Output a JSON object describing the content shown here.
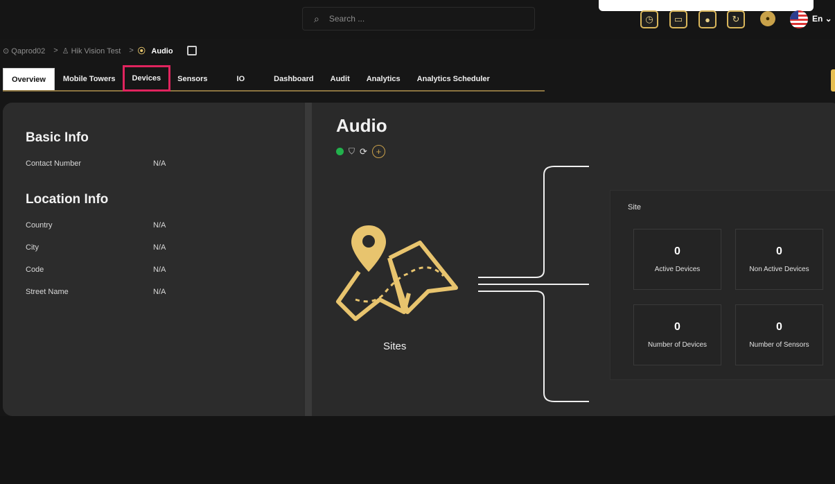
{
  "search": {
    "placeholder": "Search ..."
  },
  "topbar": {
    "lang": "En"
  },
  "breadcrumb": [
    {
      "label": "Qaprod02"
    },
    {
      "label": "Hik Vision Test"
    },
    {
      "label": "Audio"
    }
  ],
  "tabs": [
    {
      "label": "Overview"
    },
    {
      "label": "Mobile Towers"
    },
    {
      "label": "Devices"
    },
    {
      "label": "Sensors"
    },
    {
      "label": "IO"
    },
    {
      "label": "Dashboard"
    },
    {
      "label": "Audit"
    },
    {
      "label": "Analytics"
    },
    {
      "label": "Analytics Scheduler"
    }
  ],
  "basic_info": {
    "title": "Basic Info",
    "contact_number": {
      "label": "Contact Number",
      "value": "N/A"
    }
  },
  "location_info": {
    "title": "Location Info",
    "fields": [
      {
        "label": "Country",
        "value": "N/A"
      },
      {
        "label": "City",
        "value": "N/A"
      },
      {
        "label": "Code",
        "value": "N/A"
      },
      {
        "label": "Street Name",
        "value": "N/A"
      }
    ]
  },
  "main": {
    "title": "Audio",
    "sites_label": "Sites",
    "site_box": {
      "label": "Site",
      "stats": [
        {
          "value": "0",
          "label": "Active Devices"
        },
        {
          "value": "0",
          "label": "Non Active Devices"
        },
        {
          "value": "0",
          "label": "Number of Devices"
        },
        {
          "value": "0",
          "label": "Number of Sensors"
        }
      ]
    }
  },
  "colors": {
    "accent": "#d9b65b",
    "highlight": "#e0245e",
    "status_ok": "#22b14c"
  }
}
